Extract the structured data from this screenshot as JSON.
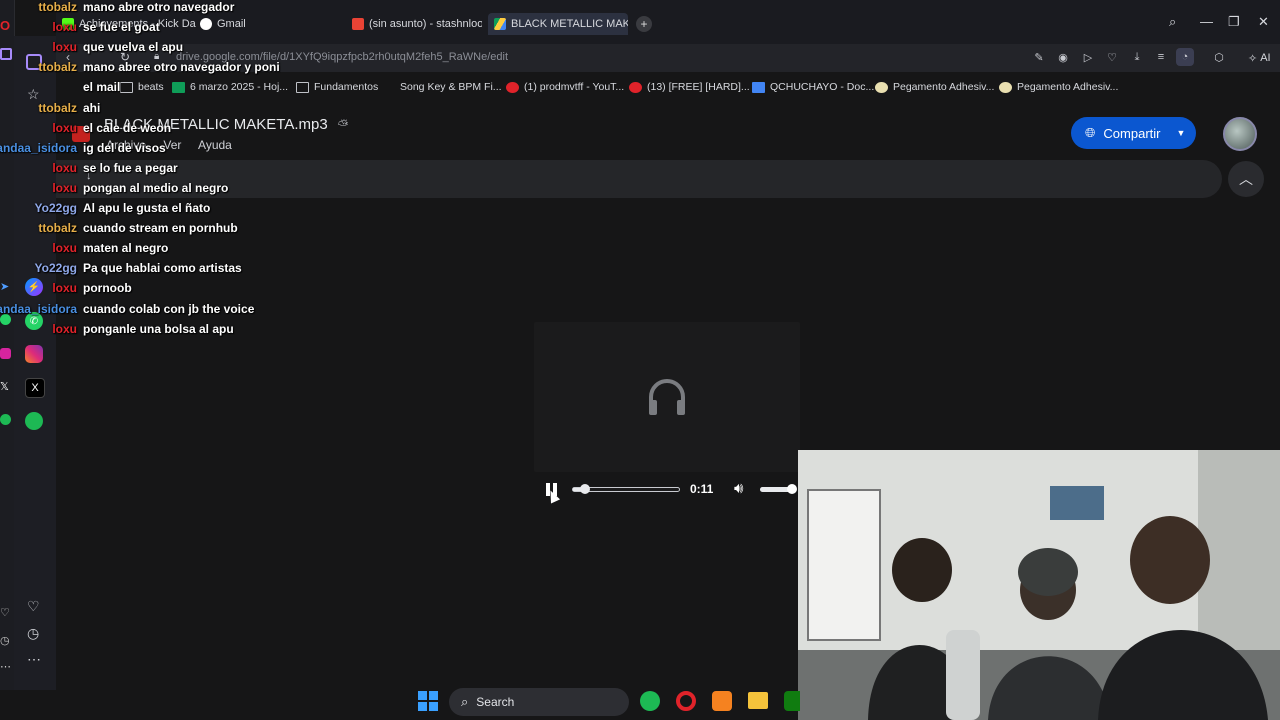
{
  "browser": {
    "tabs": [
      {
        "label": "Achievements - Kick Dash",
        "favicon_color": "#53fc18"
      },
      {
        "label": "Gmail",
        "favicon_color": "#ea4335"
      },
      {
        "label": "(sin asunto) - stashnloops",
        "favicon_color": "#ea4335"
      },
      {
        "label": "BLACK METALLIC MAK",
        "favicon_color": "#1fa463",
        "active": true
      }
    ],
    "url": "drive.google.com/file/d/1XYfQ9iqpzfpcb2rh0utqM2feh5_RaWNe/edit",
    "ai_label": "AI",
    "bookmarks": [
      {
        "label": "beats"
      },
      {
        "label": "6 marzo 2025 - Hoj..."
      },
      {
        "label": "Fundamentos"
      },
      {
        "label": "Song Key & BPM Fi..."
      },
      {
        "label": "(1) prodmvtff - YouT..."
      },
      {
        "label": "(13) [FREE] [HARD]..."
      },
      {
        "label": "QCHUCHAYO - Doc..."
      },
      {
        "label": "Pegamento Adhesiv..."
      },
      {
        "label": "Pegamento Adhesiv..."
      }
    ]
  },
  "drive": {
    "file_title": "BLACK METALLIC MAKETA.mp3",
    "menu": [
      "Archivo",
      "Ver",
      "Ayuda"
    ],
    "share_label": "Compartir",
    "share_color": "#0b57d0"
  },
  "player": {
    "time": "0:11",
    "progress": 0.11,
    "volume": 1.0
  },
  "chat": [
    {
      "user": "ttobalz",
      "color": "#e8b04a",
      "message": "mano abre otro navegador"
    },
    {
      "user": "loxu",
      "color": "#e0232a",
      "message": "se fue el goat"
    },
    {
      "user": "loxu",
      "color": "#e0232a",
      "message": "que vuelva el apu"
    },
    {
      "user": "ttobalz",
      "color": "#e8b04a",
      "message": "mano abree otro navegador y poni"
    },
    {
      "user": "",
      "color": "#e8b04a",
      "message": "el mail"
    },
    {
      "user": "ttobalz",
      "color": "#e8b04a",
      "message": "ahi"
    },
    {
      "user": "loxu",
      "color": "#e0232a",
      "message": "el cale de weon"
    },
    {
      "user": "andaa_isidora",
      "color": "#4a90e2",
      "message": "ig del de visos"
    },
    {
      "user": "loxu",
      "color": "#e0232a",
      "message": "se lo fue a pegar"
    },
    {
      "user": "loxu",
      "color": "#e0232a",
      "message": "pongan al medio al negro"
    },
    {
      "user": "Yo22gg",
      "color": "#8fa8e8",
      "message": "Al apu le gusta el ñato"
    },
    {
      "user": "ttobalz",
      "color": "#e8b04a",
      "message": "cuando stream en pornhub"
    },
    {
      "user": "loxu",
      "color": "#e0232a",
      "message": "maten al negro"
    },
    {
      "user": "Yo22gg",
      "color": "#8fa8e8",
      "message": "Pa que hablai como artistas"
    },
    {
      "user": "loxu",
      "color": "#e0232a",
      "message": "pornoob"
    },
    {
      "user": "andaa_isidora",
      "color": "#4a90e2",
      "message": "cuando colab con jb the voice"
    },
    {
      "user": "loxu",
      "color": "#e0232a",
      "message": "ponganle una bolsa al apu"
    }
  ],
  "taskbar": {
    "search_label": "Search"
  },
  "icons": {
    "sidebar": [
      "opera-logo-icon",
      "home-icon",
      "bookmark-icon",
      "messenger-icon",
      "whatsapp-icon",
      "instagram-icon",
      "x-icon",
      "spotify-icon",
      "heart-icon",
      "history-icon",
      "more-icon"
    ]
  }
}
